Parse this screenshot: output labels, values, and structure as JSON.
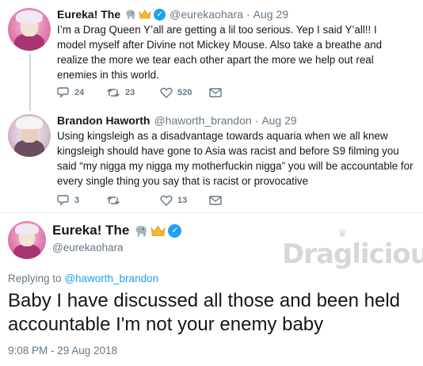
{
  "tweet1": {
    "name": "Eureka! The",
    "emoji_icons": [
      "elephant-icon",
      "crown-icon"
    ],
    "handle": "@eurekaohara",
    "separator": "·",
    "date": "Aug 29",
    "text": "I’m a Drag Queen Y’all are getting a lil too serious. Yep I said Y’all!! I model myself after Divine not Mickey Mouse. Also take a breathe and realize the more we tear each other apart the more we help out real enemies in this world.",
    "replies": "24",
    "retweets": "23",
    "likes": "520"
  },
  "tweet2": {
    "name": "Brandon Haworth",
    "handle": "@haworth_brandon",
    "separator": "·",
    "date": "Aug 29",
    "text": "Using kingsleigh as a disadvantage towards aquaria when we all knew kingsleigh should have gone to Asia was racist and before S9 filming you said “my nigga my nigga my motherfuckin nigga” you will be accountable for every single thing you say that is racist or provocative",
    "replies": "3",
    "retweets": "",
    "likes": "13"
  },
  "main_tweet": {
    "name": "Eureka! The",
    "handle": "@eurekaohara",
    "replying_prefix": "Replying to",
    "replying_to": "@haworth_brandon",
    "text": "Baby I have discussed all those and been held accountable I'm not your enemy baby",
    "timestamp": "9:08 PM - 29 Aug 2018"
  },
  "watermark": {
    "text": "Draglicious"
  },
  "colors": {
    "accent": "#1da1f2",
    "muted": "#657786",
    "text": "#14171a",
    "divider": "#e6ecf0"
  }
}
